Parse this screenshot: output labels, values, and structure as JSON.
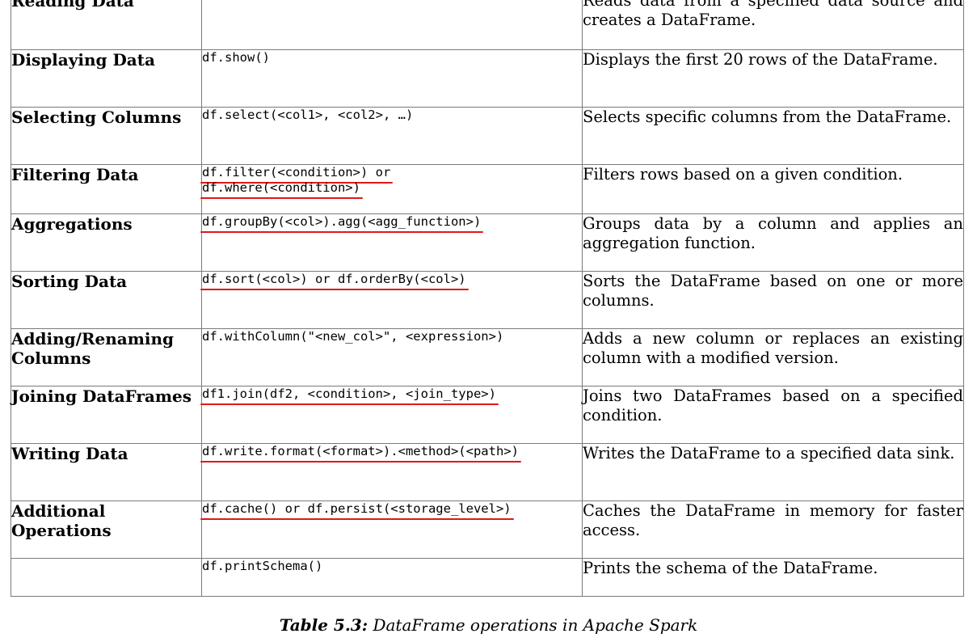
{
  "rows": [
    {
      "operation": "Reading Data",
      "code": [],
      "description": "Reads data from a specified data source and creates a DataFrame."
    },
    {
      "operation": "Displaying Data",
      "code": [
        {
          "text": "df.show()",
          "underlined": false
        }
      ],
      "description": "Displays the first 20 rows of the DataFrame."
    },
    {
      "operation": "Selecting Columns",
      "code": [
        {
          "text": "df.select(<col1>, <col2>, …)",
          "underlined": false
        }
      ],
      "description": "Selects specific columns from the DataFrame."
    },
    {
      "operation": "Filtering Data",
      "code": [
        {
          "text": "df.filter(<condition>) or",
          "underlined": true
        },
        {
          "text": "df.where(<condition>)",
          "underlined": true
        }
      ],
      "description": "Filters rows based on a given condition."
    },
    {
      "operation": "Aggregations",
      "code": [
        {
          "text": "df.groupBy(<col>).agg(<agg_function>)",
          "underlined": true
        }
      ],
      "description": "Groups data by a column and applies an aggregation function."
    },
    {
      "operation": "Sorting Data",
      "code": [
        {
          "text": "df.sort(<col>) or df.orderBy(<col>)",
          "underlined": true
        }
      ],
      "description": "Sorts the DataFrame based on one or more columns."
    },
    {
      "operation": "Adding/Renaming Columns",
      "code": [
        {
          "text": "df.withColumn(\"<new_col>\", <expression>)",
          "underlined": false
        }
      ],
      "description": "Adds a new column or replaces an existing column with a modified version."
    },
    {
      "operation": "Joining DataFrames",
      "code": [
        {
          "text": "df1.join(df2, <condition>, <join_type>)",
          "underlined": true
        }
      ],
      "description": "Joins two DataFrames based on a specified condition."
    },
    {
      "operation": "Writing Data",
      "code": [
        {
          "text": "df.write.format(<format>).<method>(<path>)",
          "underlined": true
        }
      ],
      "description": "Writes the DataFrame to a specified data sink."
    },
    {
      "operation": "Additional Operations",
      "code": [
        {
          "text": "df.cache() or df.persist(<storage_level>)",
          "underlined": true
        }
      ],
      "description": "Caches the DataFrame in memory for faster access."
    },
    {
      "operation": "",
      "code": [
        {
          "text": "df.printSchema()",
          "underlined": false
        }
      ],
      "description": "Prints the schema of the DataFrame."
    }
  ],
  "caption": {
    "label": "Table 5.3:",
    "text": "DataFrame operations in Apache Spark"
  },
  "annotation_color": "#e01818"
}
